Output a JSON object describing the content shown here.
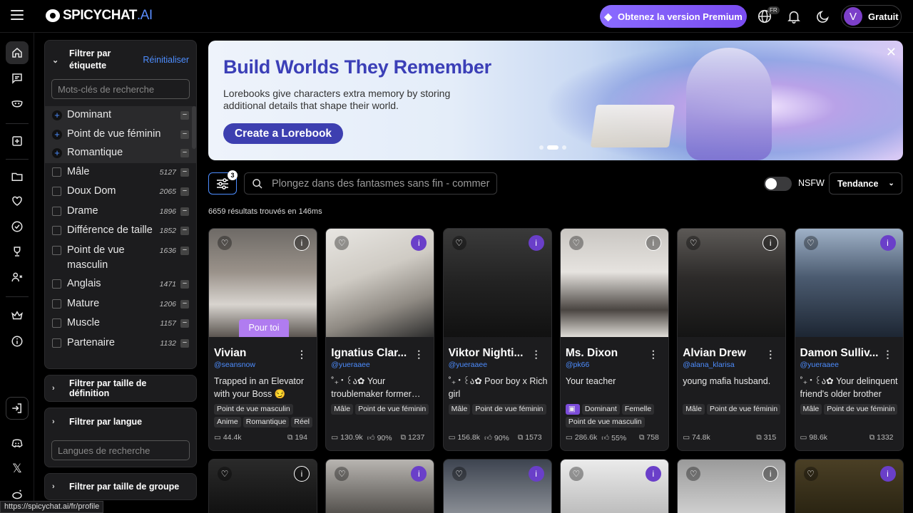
{
  "header": {
    "logo_text": "SPICYCHAT",
    "logo_suffix": ".AI",
    "premium_label": "Obtenez la version Premium",
    "lang_badge": "FR",
    "user_initial": "V",
    "user_plan": "Gratuit"
  },
  "filters": {
    "tag_panel_title": "Filtrer par étiquette",
    "reset_label": "Réinitialiser",
    "tag_search_placeholder": "Mots-clés de recherche",
    "selected_tags": [
      "Dominant",
      "Point de vue féminin",
      "Romantique"
    ],
    "tags": [
      {
        "name": "Mâle",
        "count": "5127"
      },
      {
        "name": "Doux Dom",
        "count": "2065"
      },
      {
        "name": "Drame",
        "count": "1896"
      },
      {
        "name": "Différence de taille",
        "count": "1852"
      },
      {
        "name": "Point de vue masculin",
        "count": "1636"
      },
      {
        "name": "Anglais",
        "count": "1471"
      },
      {
        "name": "Mature",
        "count": "1206"
      },
      {
        "name": "Muscle",
        "count": "1157"
      },
      {
        "name": "Partenaire",
        "count": "1132"
      }
    ],
    "definition_size_title": "Filtrer par taille de définition",
    "language_title": "Filtrer par langue",
    "language_search_placeholder": "Langues de recherche",
    "group_size_title": "Filtrer par taille de groupe"
  },
  "banner": {
    "title": "Build Worlds They Remember",
    "text": "Lorebooks give characters extra memory by storing additional details that shape their world.",
    "cta": "Create a Lorebook"
  },
  "toolbar": {
    "filter_count": "3",
    "search_placeholder": "Plongez dans des fantasmes sans fin - commer",
    "nsfw_label": "NSFW",
    "sort_label": "Tendance",
    "results_text": "6659 résultats trouvés en 146ms"
  },
  "cards": [
    {
      "name": "Vivian",
      "handle": "@seansnow",
      "desc": "Trapped in an Elevator with your Boss 😏",
      "tags": [
        "Point de vue masculin",
        "Anime",
        "Romantique",
        "Réel"
      ],
      "messages": "44.4k",
      "likes": "",
      "tokens": "194",
      "badge": "Pour toi"
    },
    {
      "name": "Ignatius Clar...",
      "handle": "@yueraaee",
      "desc": "˚₊‧꒰ა✿ Your troublemaker former…",
      "tags": [
        "Mâle",
        "Point de vue féminin"
      ],
      "messages": "130.9k",
      "likes": "90%",
      "tokens": "1237"
    },
    {
      "name": "Viktor Nighti...",
      "handle": "@yueraaee",
      "desc": "˚₊‧꒰ა✿ Poor boy x Rich girl",
      "tags": [
        "Mâle",
        "Point de vue féminin"
      ],
      "messages": "156.8k",
      "likes": "90%",
      "tokens": "1573"
    },
    {
      "name": "Ms. Dixon",
      "handle": "@pk66",
      "desc": "Your teacher",
      "tags": [
        "Dominant",
        "Femelle",
        "Point de vue masculin"
      ],
      "messages": "286.6k",
      "likes": "55%",
      "tokens": "758"
    },
    {
      "name": "Alvian Drew",
      "handle": "@alana_klarisa",
      "desc": "young mafia husband.",
      "tags": [
        "Mâle",
        "Point de vue féminin"
      ],
      "messages": "74.8k",
      "likes": "",
      "tokens": "315"
    },
    {
      "name": "Damon Sulliv...",
      "handle": "@yueraaee",
      "desc": "˚₊‧꒰ა✿ Your delinquent friend's older brother",
      "tags": [
        "Mâle",
        "Point de vue féminin"
      ],
      "messages": "98.6k",
      "likes": "",
      "tokens": "1332"
    }
  ],
  "status_url": "https://spicychat.ai/fr/profile"
}
